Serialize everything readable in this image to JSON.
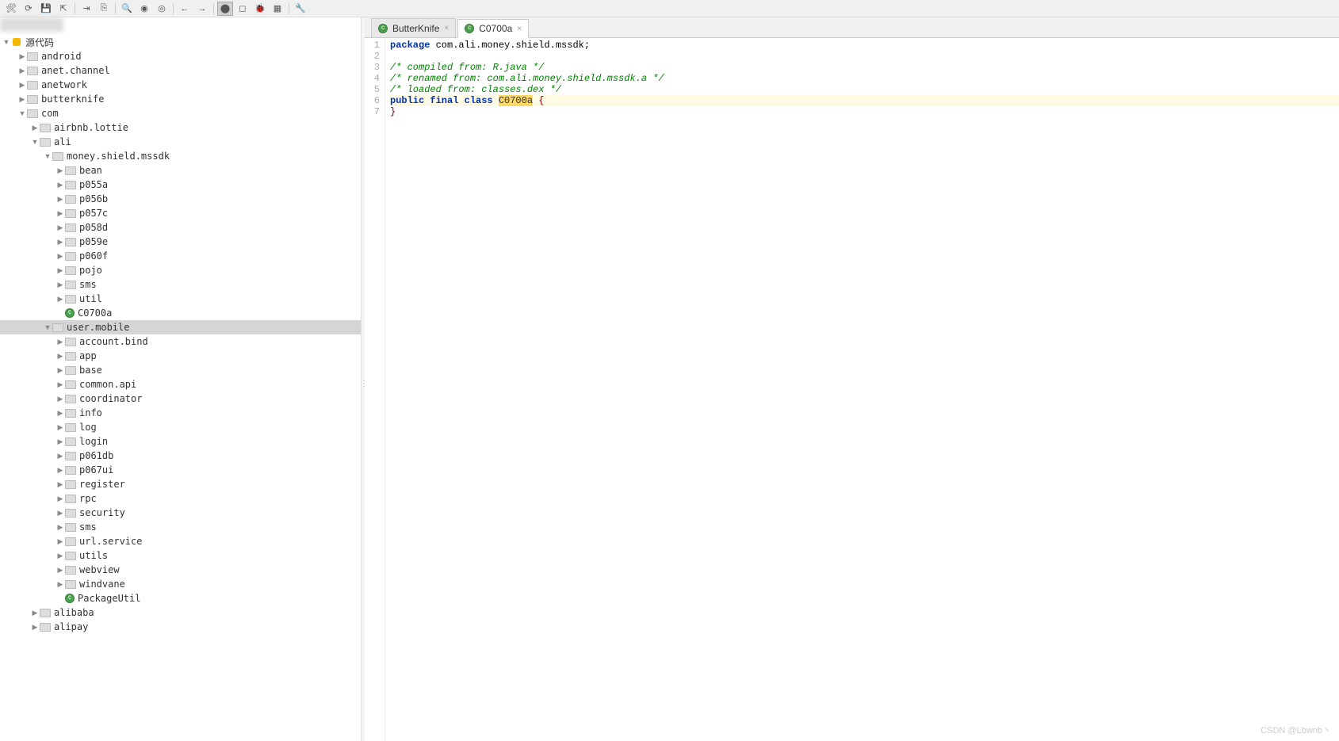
{
  "toolbar": {
    "icons": [
      "hammer",
      "refresh",
      "save",
      "export",
      "indent",
      "copy",
      "search",
      "stop-green",
      "go-green",
      "back",
      "forward",
      "bp-on",
      "bp-off",
      "bug",
      "table",
      "wrench"
    ]
  },
  "tree": {
    "root_label": "源代码",
    "items": [
      {
        "depth": 0,
        "arrow": "▶",
        "type": "folder",
        "label": "android"
      },
      {
        "depth": 0,
        "arrow": "▶",
        "type": "folder",
        "label": "anet.channel"
      },
      {
        "depth": 0,
        "arrow": "▶",
        "type": "folder",
        "label": "anetwork"
      },
      {
        "depth": 0,
        "arrow": "▶",
        "type": "folder",
        "label": "butterknife"
      },
      {
        "depth": 0,
        "arrow": "▼",
        "type": "folder",
        "label": "com"
      },
      {
        "depth": 1,
        "arrow": "▶",
        "type": "folder",
        "label": "airbnb.lottie"
      },
      {
        "depth": 1,
        "arrow": "▼",
        "type": "folder",
        "label": "ali"
      },
      {
        "depth": 2,
        "arrow": "▼",
        "type": "folder",
        "label": "money.shield.mssdk"
      },
      {
        "depth": 3,
        "arrow": "▶",
        "type": "folder",
        "label": "bean"
      },
      {
        "depth": 3,
        "arrow": "▶",
        "type": "folder",
        "label": "p055a"
      },
      {
        "depth": 3,
        "arrow": "▶",
        "type": "folder",
        "label": "p056b"
      },
      {
        "depth": 3,
        "arrow": "▶",
        "type": "folder",
        "label": "p057c"
      },
      {
        "depth": 3,
        "arrow": "▶",
        "type": "folder",
        "label": "p058d"
      },
      {
        "depth": 3,
        "arrow": "▶",
        "type": "folder",
        "label": "p059e"
      },
      {
        "depth": 3,
        "arrow": "▶",
        "type": "folder",
        "label": "p060f"
      },
      {
        "depth": 3,
        "arrow": "▶",
        "type": "folder",
        "label": "pojo"
      },
      {
        "depth": 3,
        "arrow": "▶",
        "type": "folder",
        "label": "sms"
      },
      {
        "depth": 3,
        "arrow": "▶",
        "type": "folder",
        "label": "util"
      },
      {
        "depth": 3,
        "arrow": "",
        "type": "class",
        "label": "C0700a"
      },
      {
        "depth": 2,
        "arrow": "▼",
        "type": "folder",
        "label": "user.mobile",
        "selected": true
      },
      {
        "depth": 3,
        "arrow": "▶",
        "type": "folder",
        "label": "account.bind"
      },
      {
        "depth": 3,
        "arrow": "▶",
        "type": "folder",
        "label": "app"
      },
      {
        "depth": 3,
        "arrow": "▶",
        "type": "folder",
        "label": "base"
      },
      {
        "depth": 3,
        "arrow": "▶",
        "type": "folder",
        "label": "common.api"
      },
      {
        "depth": 3,
        "arrow": "▶",
        "type": "folder",
        "label": "coordinator"
      },
      {
        "depth": 3,
        "arrow": "▶",
        "type": "folder",
        "label": "info"
      },
      {
        "depth": 3,
        "arrow": "▶",
        "type": "folder",
        "label": "log"
      },
      {
        "depth": 3,
        "arrow": "▶",
        "type": "folder",
        "label": "login"
      },
      {
        "depth": 3,
        "arrow": "▶",
        "type": "folder",
        "label": "p061db"
      },
      {
        "depth": 3,
        "arrow": "▶",
        "type": "folder",
        "label": "p067ui"
      },
      {
        "depth": 3,
        "arrow": "▶",
        "type": "folder",
        "label": "register"
      },
      {
        "depth": 3,
        "arrow": "▶",
        "type": "folder",
        "label": "rpc"
      },
      {
        "depth": 3,
        "arrow": "▶",
        "type": "folder",
        "label": "security"
      },
      {
        "depth": 3,
        "arrow": "▶",
        "type": "folder",
        "label": "sms"
      },
      {
        "depth": 3,
        "arrow": "▶",
        "type": "folder",
        "label": "url.service"
      },
      {
        "depth": 3,
        "arrow": "▶",
        "type": "folder",
        "label": "utils"
      },
      {
        "depth": 3,
        "arrow": "▶",
        "type": "folder",
        "label": "webview"
      },
      {
        "depth": 3,
        "arrow": "▶",
        "type": "folder",
        "label": "windvane"
      },
      {
        "depth": 3,
        "arrow": "",
        "type": "class",
        "label": "PackageUtil"
      },
      {
        "depth": 1,
        "arrow": "▶",
        "type": "folder",
        "label": "alibaba"
      },
      {
        "depth": 1,
        "arrow": "▶",
        "type": "folder",
        "label": "alipay"
      }
    ]
  },
  "tabs": [
    {
      "label": "ButterKnife",
      "active": false
    },
    {
      "label": "C0700a",
      "active": true
    }
  ],
  "code": {
    "lines": [
      {
        "n": 1,
        "tokens": [
          {
            "t": "package ",
            "c": "kw"
          },
          {
            "t": "com.ali.money.shield.mssdk;",
            "c": "pkg"
          }
        ]
      },
      {
        "n": 2,
        "tokens": [
          {
            "t": "",
            "c": ""
          }
        ]
      },
      {
        "n": 3,
        "tokens": [
          {
            "t": "/* compiled from: R.java */",
            "c": "comment"
          }
        ]
      },
      {
        "n": 4,
        "tokens": [
          {
            "t": "/* renamed from: com.ali.money.shield.mssdk.a */",
            "c": "comment"
          }
        ]
      },
      {
        "n": 5,
        "tokens": [
          {
            "t": "/* loaded from: classes.dex */",
            "c": "comment"
          }
        ]
      },
      {
        "n": 6,
        "hl": true,
        "tokens": [
          {
            "t": "public final class ",
            "c": "kw"
          },
          {
            "t": "C0700a",
            "c": "hl-name"
          },
          {
            "t": " {",
            "c": "brace"
          }
        ]
      },
      {
        "n": 7,
        "tokens": [
          {
            "t": "}",
            "c": "brace"
          }
        ]
      }
    ]
  },
  "watermark": "CSDN @Lbwnb丶"
}
